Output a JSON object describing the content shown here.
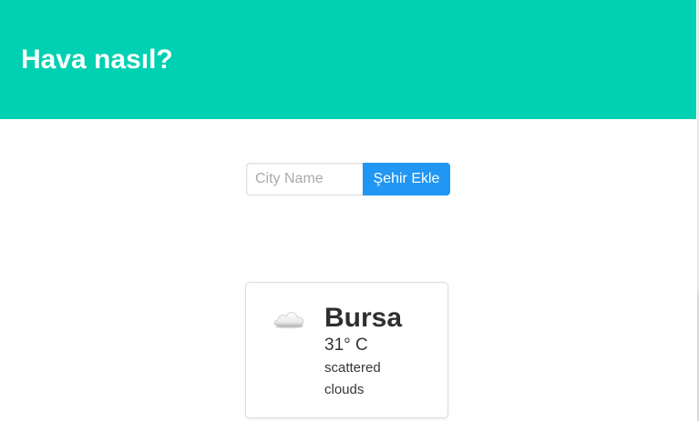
{
  "header": {
    "title": "Hava nasıl?"
  },
  "search": {
    "placeholder": "City Name",
    "value": "",
    "button_label": "Şehir Ekle"
  },
  "weather_card": {
    "city": "Bursa",
    "temperature": "31° C",
    "description": "scattered clouds",
    "icon": "cloud-icon"
  },
  "colors": {
    "hero_background": "#00d1b2",
    "button_background": "#2196f3"
  }
}
